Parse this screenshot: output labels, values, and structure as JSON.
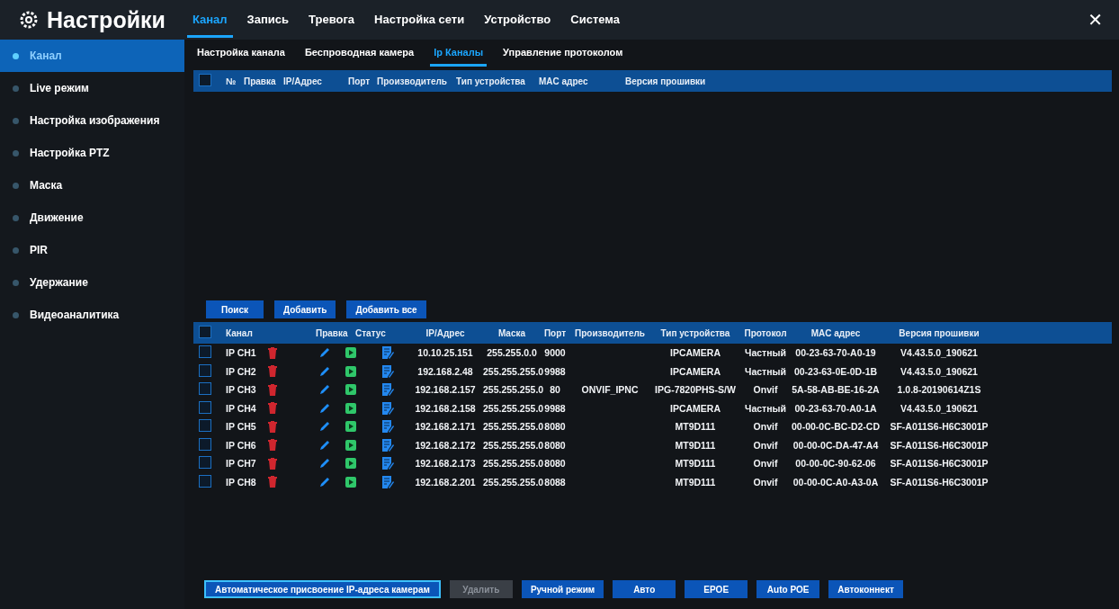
{
  "header": {
    "title": "Настройки",
    "close": "✕",
    "tabs": [
      {
        "label": "Канал",
        "selected": true
      },
      {
        "label": "Запись",
        "selected": false
      },
      {
        "label": "Тревога",
        "selected": false
      },
      {
        "label": "Настройка сети",
        "selected": false
      },
      {
        "label": "Устройство",
        "selected": false
      },
      {
        "label": "Система",
        "selected": false
      }
    ]
  },
  "sidebar": {
    "items": [
      {
        "label": "Канал",
        "selected": true
      },
      {
        "label": "Live режим",
        "selected": false
      },
      {
        "label": "Настройка изображения",
        "selected": false
      },
      {
        "label": "Настройка PTZ",
        "selected": false
      },
      {
        "label": "Маска",
        "selected": false
      },
      {
        "label": "Движение",
        "selected": false
      },
      {
        "label": "PIR",
        "selected": false
      },
      {
        "label": "Удержание",
        "selected": false
      },
      {
        "label": "Видеоаналитика",
        "selected": false
      }
    ]
  },
  "subtabs": [
    {
      "label": "Настройка канала",
      "selected": false
    },
    {
      "label": "Беспроводная камера",
      "selected": false
    },
    {
      "label": "Ip Каналы",
      "selected": true
    },
    {
      "label": "Управление протоколом",
      "selected": false
    }
  ],
  "search_table": {
    "checked": false,
    "columns": [
      "№",
      "Правка",
      "IP/Адрес",
      "Порт",
      "Производитель",
      "Тип устройства",
      "MAC адрес",
      "Версия прошивки"
    ]
  },
  "search_buttons": [
    "Поиск",
    "Добавить",
    "Добавить все"
  ],
  "channel_table": {
    "checked": false,
    "columns": [
      "Канал",
      "Правка",
      "Статус",
      "IP/Адрес",
      "Маска",
      "Порт",
      "Производитель",
      "Тип устройства",
      "Протокол",
      "MAC адрес",
      "Версия прошивки"
    ],
    "rows": [
      {
        "checked": false,
        "channel": "IP CH1",
        "ip": "10.10.25.151",
        "mask": "255.255.0.0",
        "port": "9000",
        "manufacturer": "",
        "device_type": "IPCAMERA",
        "protocol": "Частный",
        "mac": "00-23-63-70-A0-19",
        "firmware": "V4.43.5.0_190621"
      },
      {
        "checked": false,
        "channel": "IP CH2",
        "ip": "192.168.2.48",
        "mask": "255.255.255.0",
        "port": "9988",
        "manufacturer": "",
        "device_type": "IPCAMERA",
        "protocol": "Частный",
        "mac": "00-23-63-0E-0D-1B",
        "firmware": "V4.43.5.0_190621"
      },
      {
        "checked": false,
        "channel": "IP CH3",
        "ip": "192.168.2.157",
        "mask": "255.255.255.0",
        "port": "80",
        "manufacturer": "ONVIF_IPNC",
        "device_type": "IPG-7820PHS-S/W",
        "protocol": "Onvif",
        "mac": "5A-58-AB-BE-16-2A",
        "firmware": "1.0.8-20190614Z1S"
      },
      {
        "checked": false,
        "channel": "IP CH4",
        "ip": "192.168.2.158",
        "mask": "255.255.255.0",
        "port": "9988",
        "manufacturer": "",
        "device_type": "IPCAMERA",
        "protocol": "Частный",
        "mac": "00-23-63-70-A0-1A",
        "firmware": "V4.43.5.0_190621"
      },
      {
        "checked": false,
        "channel": "IP CH5",
        "ip": "192.168.2.171",
        "mask": "255.255.255.0",
        "port": "8080",
        "manufacturer": "",
        "device_type": "MT9D111",
        "protocol": "Onvif",
        "mac": "00-00-0C-BC-D2-CD",
        "firmware": "SF-A011S6-H6C3001P"
      },
      {
        "checked": false,
        "channel": "IP CH6",
        "ip": "192.168.2.172",
        "mask": "255.255.255.0",
        "port": "8080",
        "manufacturer": "",
        "device_type": "MT9D111",
        "protocol": "Onvif",
        "mac": "00-00-0C-DA-47-A4",
        "firmware": "SF-A011S6-H6C3001P"
      },
      {
        "checked": false,
        "channel": "IP CH7",
        "ip": "192.168.2.173",
        "mask": "255.255.255.0",
        "port": "8080",
        "manufacturer": "",
        "device_type": "MT9D111",
        "protocol": "Onvif",
        "mac": "00-00-0C-90-62-06",
        "firmware": "SF-A011S6-H6C3001P"
      },
      {
        "checked": false,
        "channel": "IP CH8",
        "ip": "192.168.2.201",
        "mask": "255.255.255.0",
        "port": "8088",
        "manufacturer": "",
        "device_type": "MT9D111",
        "protocol": "Onvif",
        "mac": "00-00-0C-A0-A3-0A",
        "firmware": "SF-A011S6-H6C3001P"
      }
    ]
  },
  "bottom_buttons": [
    {
      "label": "Автоматическое присвоение IP-адреса камерам",
      "disabled": false,
      "focused": true
    },
    {
      "label": "Удалить",
      "disabled": true,
      "focused": false
    },
    {
      "label": "Ручной режим",
      "disabled": false,
      "focused": false
    },
    {
      "label": "Авто",
      "disabled": false,
      "focused": false
    },
    {
      "label": "EPOE",
      "disabled": false,
      "focused": false
    },
    {
      "label": "Auto POE",
      "disabled": false,
      "focused": false
    },
    {
      "label": "Автоконнект",
      "disabled": false,
      "focused": false
    }
  ]
}
